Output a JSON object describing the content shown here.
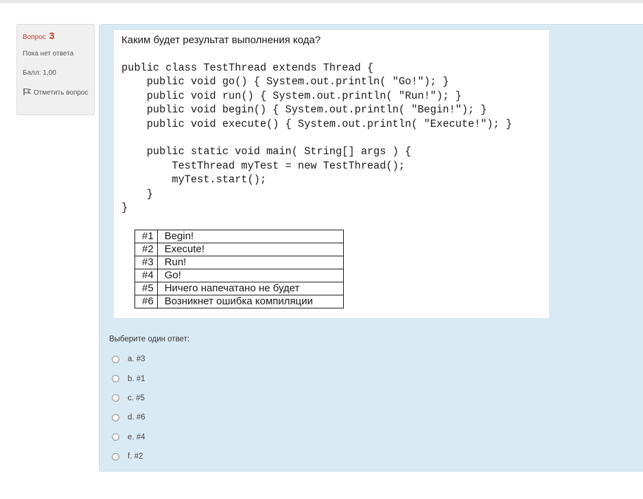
{
  "info": {
    "question_label": "Вопрос",
    "question_number": "3",
    "state": "Пока нет ответа",
    "grade": "Балл: 1,00",
    "flag_label": "Отметить вопрос",
    "flag_icon": "flag-icon"
  },
  "question": {
    "title": "Каким будет результат выполнения кода?",
    "code_lines": [
      "public class TestThread extends Thread {",
      "    public void go() { System.out.println( \"Go!\"); }",
      "    public void run() { System.out.println( \"Run!\"); }",
      "    public void begin() { System.out.println( \"Begin!\"); }",
      "    public void execute() { System.out.println( \"Execute!\"); }",
      "",
      "    public static void main( String[] args ) {",
      "        TestThread myTest = new TestThread();",
      "        myTest.start();",
      "    }",
      "}"
    ],
    "options_table": [
      {
        "key": "#1",
        "value": "Begin!"
      },
      {
        "key": "#2",
        "value": "Execute!"
      },
      {
        "key": "#3",
        "value": "Run!"
      },
      {
        "key": "#4",
        "value": "Go!"
      },
      {
        "key": "#5",
        "value": "Ничего напечатано не будет"
      },
      {
        "key": "#6",
        "value": "Возникнет ошибка компиляции"
      }
    ]
  },
  "prompt": "Выберите один ответ:",
  "answers": [
    {
      "label": "a. #3"
    },
    {
      "label": "b. #1"
    },
    {
      "label": "c. #5"
    },
    {
      "label": "d. #6"
    },
    {
      "label": "e. #4"
    },
    {
      "label": "f. #2"
    }
  ],
  "colors": {
    "panel_bg": "#daeaf4",
    "info_bg": "#f0f0f0",
    "question_number": "#c0392b"
  }
}
